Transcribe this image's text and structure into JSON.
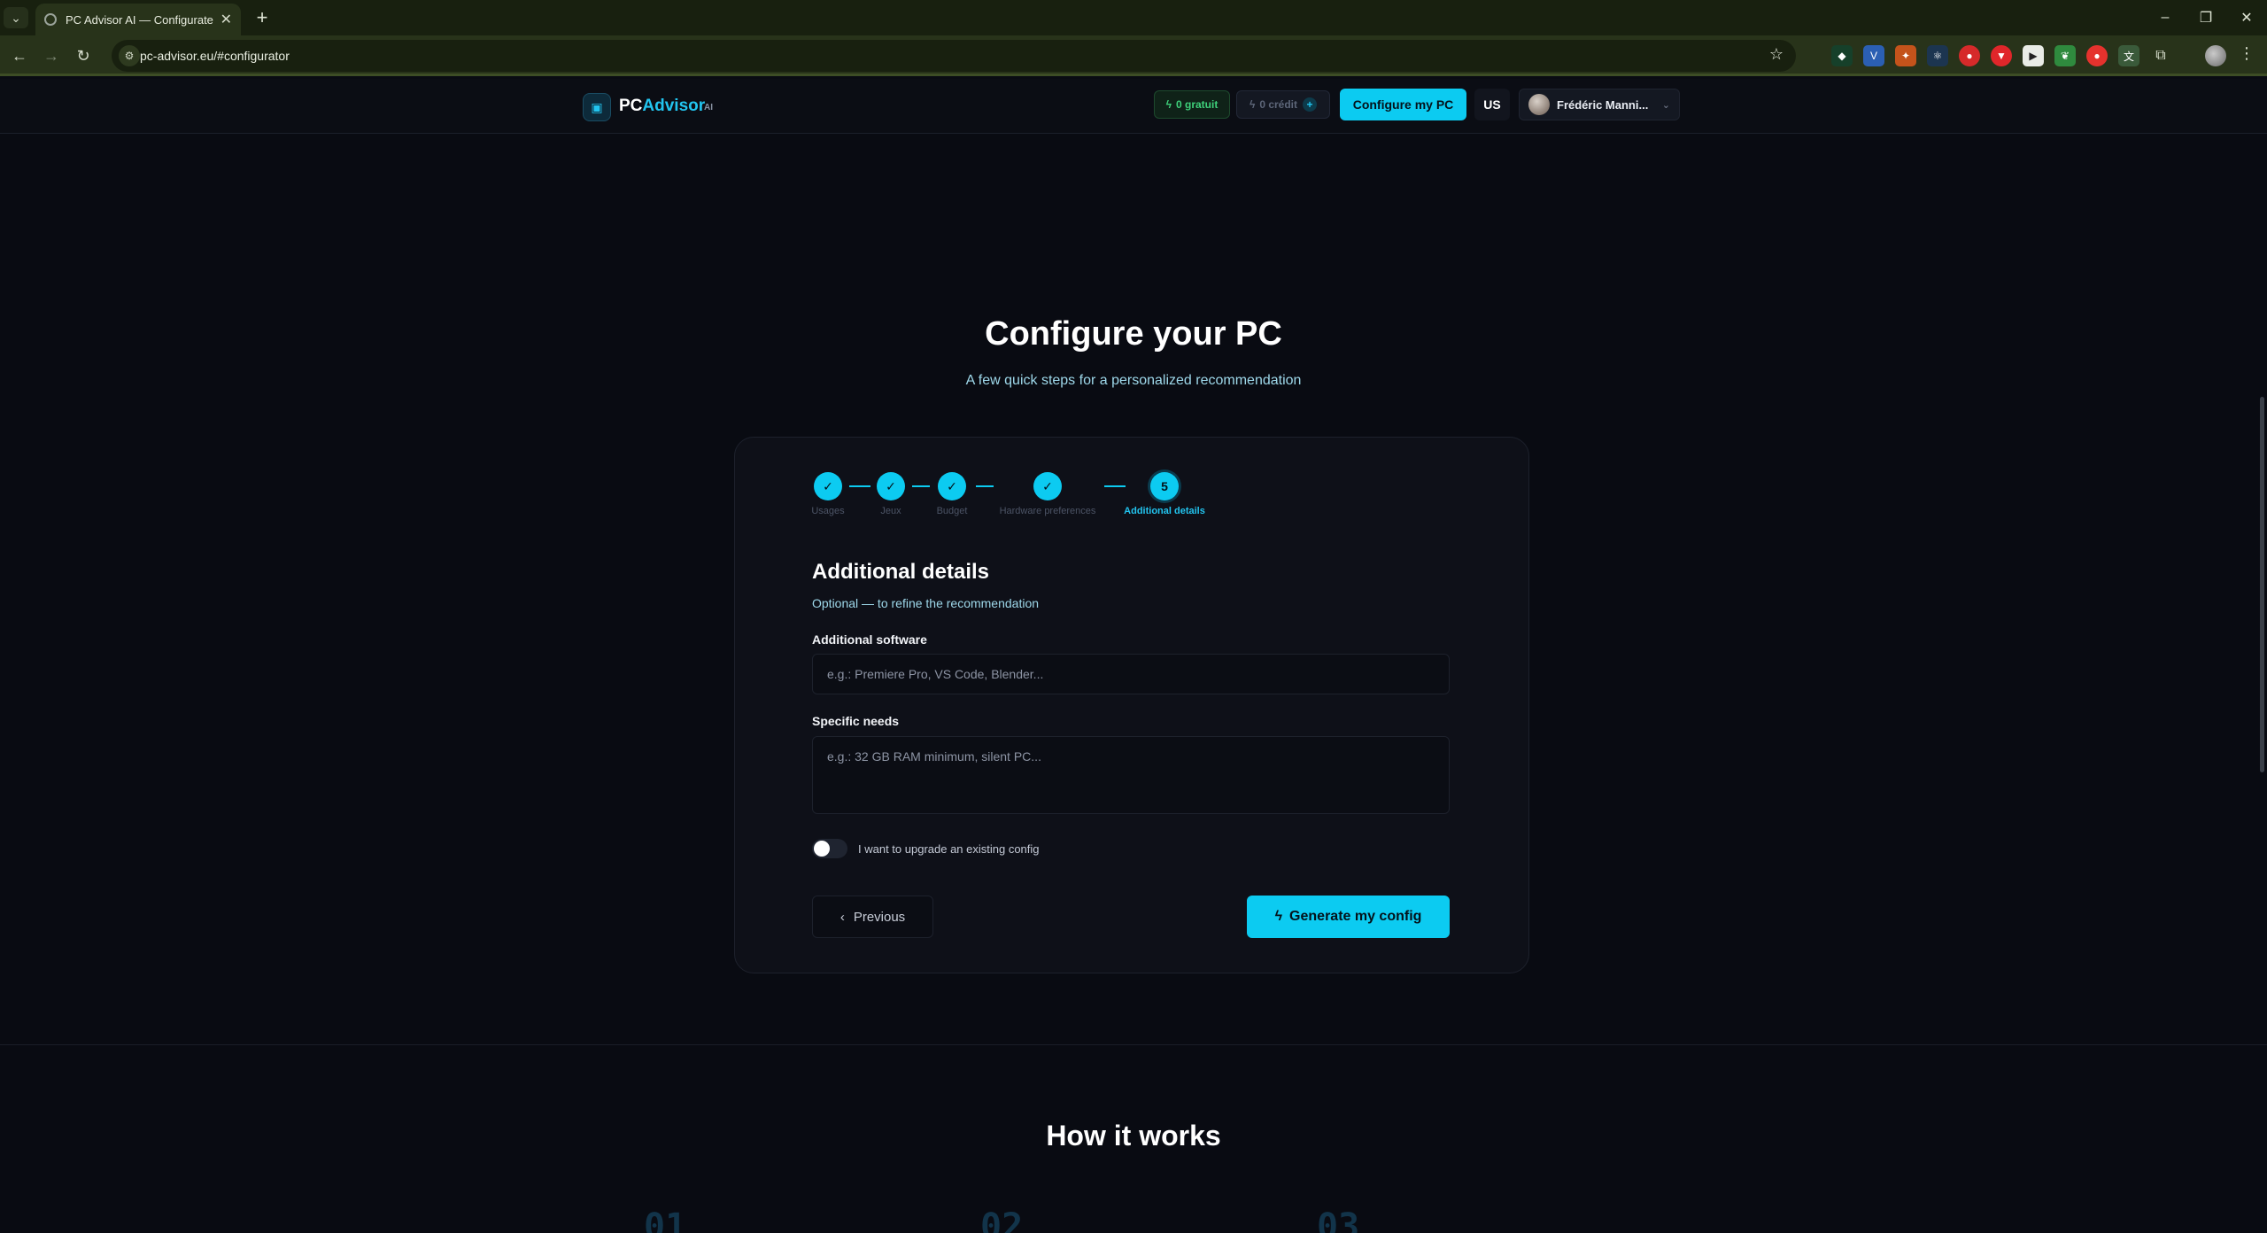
{
  "browser": {
    "tab_title": "PC Advisor AI — Configurateur",
    "url": "pc-advisor.eu/#configurator",
    "window_controls": [
      "minimize-icon",
      "restore-icon",
      "close-icon"
    ],
    "extensions": [
      "shield-ext-icon",
      "va-ext-icon",
      "fox-ext-icon",
      "react-ext-icon",
      "recorder-ext-icon",
      "pin-ext-icon",
      "play-ext-icon",
      "leaf-ext-icon",
      "red-circle-ext-icon",
      "translate-ext-icon",
      "puzzle-icon"
    ]
  },
  "header": {
    "logo_pc": "PC",
    "logo_advisor": "Advisor",
    "logo_ai": "AI",
    "free_label": "0 gratuit",
    "credit_label": "0 crédit",
    "configure_label": "Configure my PC",
    "lang": "US",
    "user_name": "Frédéric Manni..."
  },
  "main": {
    "title": "Configure your PC",
    "subtitle": "A few quick steps for a personalized recommendation"
  },
  "steps": [
    {
      "label": "Usages",
      "mark": "✓",
      "state": "done"
    },
    {
      "label": "Jeux",
      "mark": "✓",
      "state": "done"
    },
    {
      "label": "Budget",
      "mark": "✓",
      "state": "done"
    },
    {
      "label": "Hardware preferences",
      "mark": "✓",
      "state": "done"
    },
    {
      "label": "Additional details",
      "mark": "5",
      "state": "active"
    }
  ],
  "form": {
    "section_title": "Additional details",
    "section_subtitle": "Optional — to refine the recommendation",
    "software_label": "Additional software",
    "software_placeholder": "e.g.: Premiere Pro, VS Code, Blender...",
    "needs_label": "Specific needs",
    "needs_placeholder": "e.g.: 32 GB RAM minimum, silent PC...",
    "toggle_label": "I want to upgrade an existing config",
    "toggle_on": false,
    "prev_label": "Previous",
    "generate_label": "Generate my config"
  },
  "how": {
    "title": "How it works",
    "numbers": [
      "01",
      "02",
      "03"
    ]
  },
  "colors": {
    "accent": "#0ccbf1",
    "background": "#090b12",
    "card": "#0e1018"
  }
}
